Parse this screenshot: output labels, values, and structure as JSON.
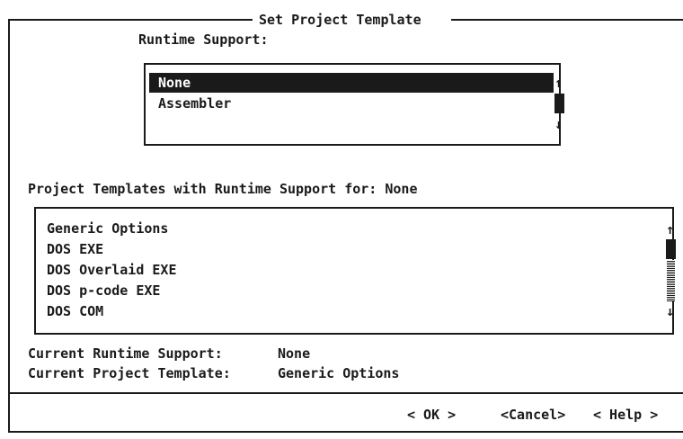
{
  "dialog": {
    "title": "Set Project Template"
  },
  "runtime": {
    "label": "Runtime Support:",
    "items": [
      "None",
      "Assembler"
    ],
    "selected": "None",
    "scroll_up_icon": "arrow-up",
    "scroll_down_icon": "arrow-down"
  },
  "templates": {
    "label_prefix": "Project Templates with Runtime Support for:",
    "label_value": "None",
    "items": [
      "Generic Options",
      "DOS EXE",
      "DOS Overlaid EXE",
      "DOS p-code EXE",
      "DOS COM"
    ],
    "scroll_up_icon": "arrow-up",
    "scroll_down_icon": "arrow-down"
  },
  "status": {
    "runtime_label": "Current Runtime Support:",
    "runtime_value": "None",
    "template_label": "Current Project Template:",
    "template_value": "Generic Options"
  },
  "buttons": {
    "ok": "< OK >",
    "cancel": "<Cancel>",
    "help": "< Help >"
  },
  "colors": {
    "foreground": "#1a1a1a",
    "background": "#ffffff"
  }
}
